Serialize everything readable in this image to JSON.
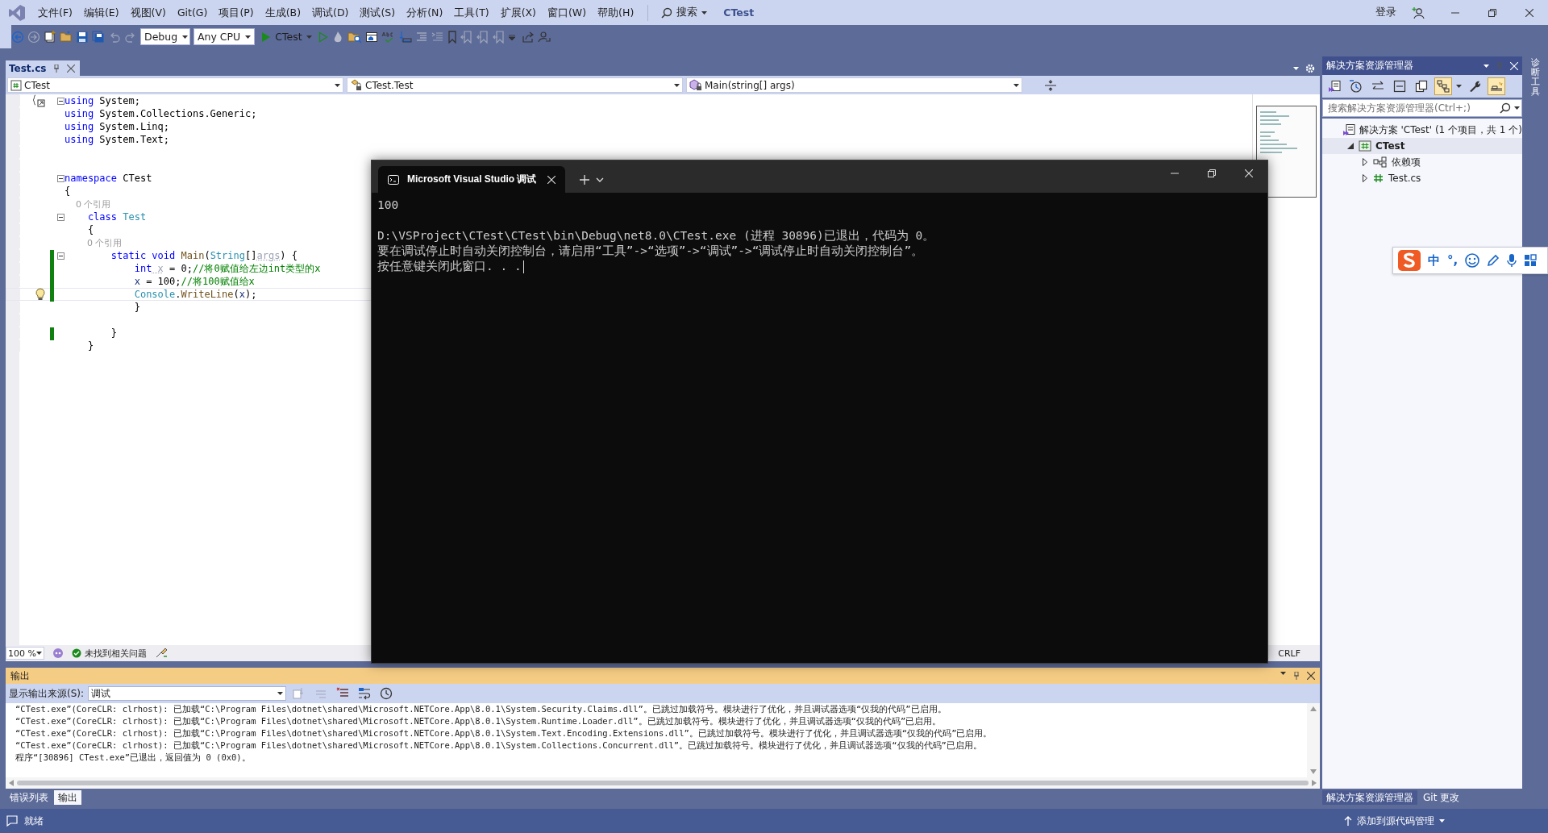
{
  "title_bar": {
    "menus": [
      "文件(F)",
      "编辑(E)",
      "视图(V)",
      "Git(G)",
      "项目(P)",
      "生成(B)",
      "调试(D)",
      "测试(S)",
      "分析(N)",
      "工具(T)",
      "扩展(X)",
      "窗口(W)",
      "帮助(H)"
    ],
    "search": "搜索",
    "solution_name": "CTest",
    "sign_in": "登录"
  },
  "toolbar": {
    "configuration": "Debug",
    "platform": "Any CPU",
    "start_target": "CTest"
  },
  "editor": {
    "tabs": [
      {
        "label": "Test.cs",
        "selected": true
      }
    ],
    "nav": {
      "project": "CTest",
      "type": "CTest.Test",
      "member": "Main(string[] args)"
    },
    "lines": [
      {
        "tokens": [
          {
            "kind": "keyword",
            "text": "using"
          },
          {
            "kind": "plain",
            "text": " System;"
          }
        ],
        "fold": true,
        "changed": false,
        "current": false,
        "lightbulb": false
      },
      {
        "tokens": [
          {
            "kind": "keyword",
            "text": "using"
          },
          {
            "kind": "plain",
            "text": " System.Collections.Generic;"
          }
        ],
        "fold": false,
        "changed": false,
        "current": false,
        "lightbulb": false
      },
      {
        "tokens": [
          {
            "kind": "keyword",
            "text": "using"
          },
          {
            "kind": "plain",
            "text": " System.Linq;"
          }
        ],
        "fold": false,
        "changed": false,
        "current": false,
        "lightbulb": false
      },
      {
        "tokens": [
          {
            "kind": "keyword",
            "text": "using"
          },
          {
            "kind": "plain",
            "text": " System.Text;"
          }
        ],
        "fold": false,
        "changed": false,
        "current": false,
        "lightbulb": false
      },
      {
        "fold": false,
        "changed": false,
        "current": false,
        "lightbulb": false
      },
      {
        "fold": false,
        "changed": false,
        "current": false,
        "lightbulb": false
      },
      {
        "tokens": [
          {
            "kind": "keyword",
            "text": "namespace"
          },
          {
            "kind": "plain",
            "text": " CTest"
          }
        ],
        "fold": true,
        "changed": false,
        "current": false,
        "lightbulb": false
      },
      {
        "tokens": [
          {
            "kind": "plain",
            "text": "{"
          }
        ],
        "fold": false,
        "changed": false,
        "current": false,
        "lightbulb": false
      },
      {
        "tokens": [
          {
            "kind": "reference_count",
            "text": "    0 个引用"
          }
        ],
        "fold": false,
        "changed": false,
        "current": false,
        "lightbulb": false
      },
      {
        "tokens": [
          {
            "kind": "keyword",
            "text": "    class"
          },
          {
            "kind": "type",
            "text": " Test"
          }
        ],
        "fold": true,
        "changed": false,
        "current": false,
        "lightbulb": false
      },
      {
        "tokens": [
          {
            "kind": "plain",
            "text": "    {"
          }
        ],
        "fold": false,
        "changed": false,
        "current": false,
        "lightbulb": false
      },
      {
        "tokens": [
          {
            "kind": "reference_count",
            "text": "        0 个引用"
          }
        ],
        "fold": false,
        "changed": false,
        "current": false,
        "lightbulb": false
      },
      {
        "tokens": [
          {
            "kind": "keyword",
            "text": "        static void"
          },
          {
            "kind": "method",
            "text": " Main"
          },
          {
            "kind": "plain",
            "text": "("
          },
          {
            "kind": "type",
            "text": "String"
          },
          {
            "kind": "plain",
            "text": "[]"
          },
          {
            "kind": "unused",
            "text": "args"
          },
          {
            "kind": "plain",
            "text": ") {"
          }
        ],
        "fold": true,
        "changed": true,
        "current": false,
        "lightbulb": false
      },
      {
        "tokens": [
          {
            "kind": "keyword",
            "text": "            int"
          },
          {
            "kind": "unused",
            "text": " x"
          },
          {
            "kind": "plain",
            "text": " = 0;"
          },
          {
            "kind": "comment",
            "text": "//将0赋值给左边int类型的x"
          }
        ],
        "fold": false,
        "changed": true,
        "current": false,
        "lightbulb": false
      },
      {
        "tokens": [
          {
            "kind": "local",
            "text": "            x"
          },
          {
            "kind": "plain",
            "text": " = 100;"
          },
          {
            "kind": "comment",
            "text": "//将100赋值给x"
          }
        ],
        "fold": false,
        "changed": true,
        "current": false,
        "lightbulb": false
      },
      {
        "tokens": [
          {
            "kind": "type",
            "text": "            Console"
          },
          {
            "kind": "plain",
            "text": "."
          },
          {
            "kind": "method",
            "text": "WriteLine"
          },
          {
            "kind": "plain",
            "text": "("
          },
          {
            "kind": "local",
            "text": "x"
          },
          {
            "kind": "plain",
            "text": ");"
          }
        ],
        "fold": false,
        "changed": true,
        "current": true,
        "lightbulb": true
      },
      {
        "tokens": [
          {
            "kind": "plain",
            "text": "            }"
          }
        ],
        "fold": false,
        "changed": false,
        "current": false,
        "lightbulb": false
      },
      {
        "fold": false,
        "changed": false,
        "current": false,
        "lightbulb": false
      },
      {
        "tokens": [
          {
            "kind": "plain",
            "text": "        }"
          }
        ],
        "fold": false,
        "changed": true,
        "current": false,
        "lightbulb": false
      },
      {
        "tokens": [
          {
            "kind": "plain",
            "text": "    }"
          }
        ],
        "fold": false,
        "changed": false,
        "current": false,
        "lightbulb": false
      }
    ],
    "zoom": "100 %",
    "issues": "未找到相关问题",
    "line_ending": "CRLF"
  },
  "console": {
    "title": "Microsoft Visual Studio 调试",
    "blocks": [
      [
        "100"
      ],
      [
        "D:\\VSProject\\CTest\\CTest\\bin\\Debug\\net8.0\\CTest.exe (进程 30896)已退出，代码为 0。",
        "要在调试停止时自动关闭控制台，请启用“工具”->“选项”->“调试”->“调试停止时自动关闭控制台”。",
        "按任意键关闭此窗口. . ."
      ]
    ],
    "cursor": true
  },
  "output": {
    "title": "输出",
    "source_label": "显示输出来源(S):",
    "source": "调试",
    "lines": [
      "“CTest.exe”(CoreCLR: clrhost): 已加载“C:\\Program Files\\dotnet\\shared\\Microsoft.NETCore.App\\8.0.1\\System.Security.Claims.dll”。已跳过加载符号。模块进行了优化，并且调试器选项“仅我的代码”已启用。",
      "“CTest.exe”(CoreCLR: clrhost): 已加载“C:\\Program Files\\dotnet\\shared\\Microsoft.NETCore.App\\8.0.1\\System.Runtime.Loader.dll”。已跳过加载符号。模块进行了优化，并且调试器选项“仅我的代码”已启用。",
      "“CTest.exe”(CoreCLR: clrhost): 已加载“C:\\Program Files\\dotnet\\shared\\Microsoft.NETCore.App\\8.0.1\\System.Text.Encoding.Extensions.dll”。已跳过加载符号。模块进行了优化，并且调试器选项“仅我的代码”已启用。",
      "“CTest.exe”(CoreCLR: clrhost): 已加载“C:\\Program Files\\dotnet\\shared\\Microsoft.NETCore.App\\8.0.1\\System.Collections.Concurrent.dll”。已跳过加载符号。模块进行了优化，并且调试器选项“仅我的代码”已启用。",
      "程序“[30896] CTest.exe”已退出，返回值为 0 (0x0)。"
    ]
  },
  "bottom_tabs": [
    {
      "label": "错误列表",
      "selected": false
    },
    {
      "label": "输出",
      "selected": true
    }
  ],
  "solution_explorer": {
    "title": "解决方案资源管理器",
    "view_toggles": [
      {
        "selected": true
      },
      {
        "selected": true
      }
    ],
    "search": {
      "placeholder": "搜索解决方案资源管理器(Ctrl+;)"
    },
    "tree": [
      {
        "kind": "solution",
        "label": "解决方案 'CTest' (1 个项目，共 1 个)",
        "selected": false,
        "children": [
          {
            "kind": "project",
            "label": "CTest",
            "selected": true,
            "expanded": true,
            "children": [
              {
                "kind": "dependencies",
                "label": "依赖项",
                "selected": false,
                "expanded": false
              },
              {
                "kind": "file",
                "label": "Test.cs",
                "selected": false,
                "expanded": false
              }
            ]
          }
        ]
      }
    ],
    "tabs": [
      {
        "label": "解决方案资源管理器",
        "selected": true
      },
      {
        "label": "Git 更改",
        "selected": false
      }
    ]
  },
  "side_tab": "诊断工具",
  "ime": {
    "mode": "中",
    "punctuation": "°,"
  },
  "status_bar": {
    "state": "就绪",
    "source_control": "添加到源代码管理"
  }
}
